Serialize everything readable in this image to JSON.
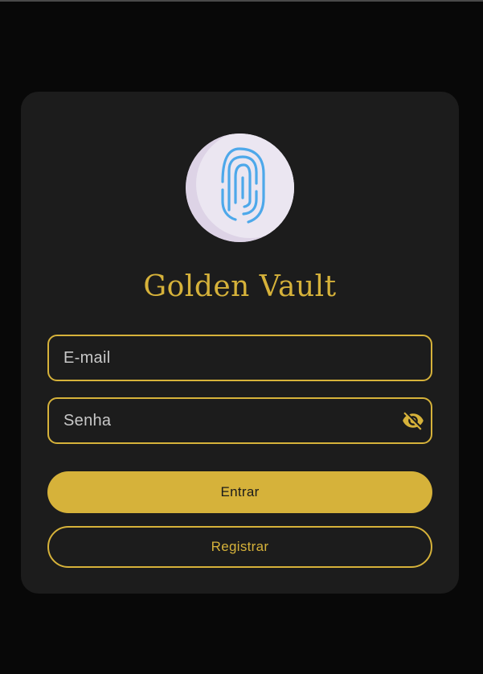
{
  "app": {
    "title": "Golden Vault",
    "logo_icon": "fingerprint-icon",
    "accent_color": "#d6b23a",
    "background_color": "#080808",
    "card_color": "#1c1c1c"
  },
  "form": {
    "email": {
      "placeholder": "E-mail",
      "value": ""
    },
    "password": {
      "placeholder": "Senha",
      "value": "",
      "toggle_icon": "eye-off-icon"
    }
  },
  "actions": {
    "login_label": "Entrar",
    "register_label": "Registrar"
  }
}
